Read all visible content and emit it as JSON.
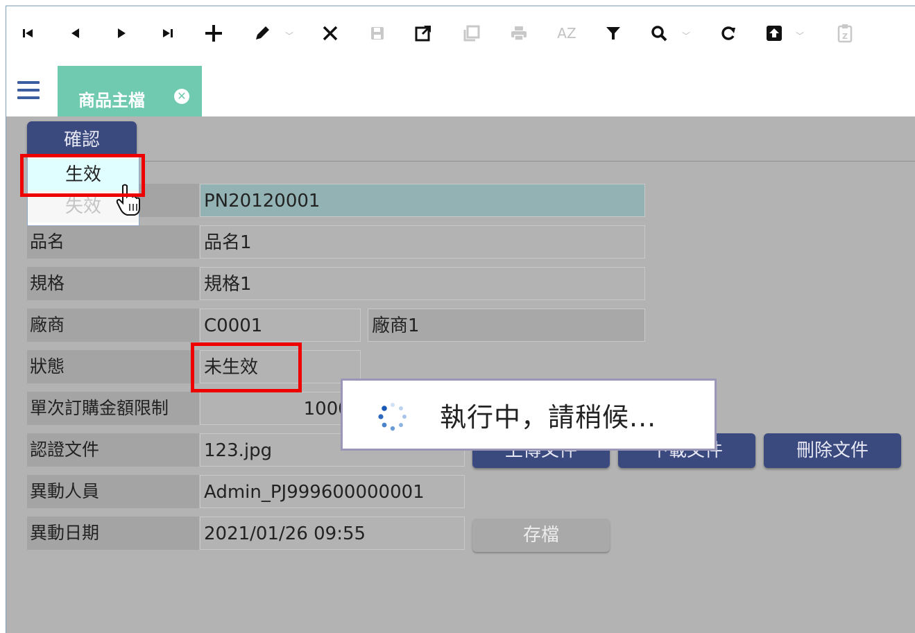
{
  "toolbar": {
    "buttons": [
      {
        "name": "first-record-button",
        "glyph": "⏮",
        "enabled": true
      },
      {
        "name": "prev-record-button",
        "glyph": "◀",
        "enabled": true
      },
      {
        "name": "next-record-button",
        "glyph": "▶",
        "enabled": true
      },
      {
        "name": "last-record-button",
        "glyph": "⏭",
        "enabled": true
      },
      {
        "name": "add-button",
        "glyph": "+",
        "enabled": true
      },
      {
        "name": "edit-button",
        "glyph": "✎",
        "enabled": true
      },
      {
        "name": "delete-button",
        "glyph": "✕",
        "enabled": true
      },
      {
        "name": "save-button",
        "glyph": "💾",
        "enabled": false
      },
      {
        "name": "open-external-button",
        "glyph": "⧉",
        "enabled": true
      },
      {
        "name": "copy-button",
        "glyph": "❐",
        "enabled": false
      },
      {
        "name": "print-button",
        "glyph": "⎙",
        "enabled": false
      },
      {
        "name": "sort-az-button",
        "glyph": "AZ",
        "enabled": false
      },
      {
        "name": "filter-button",
        "glyph": "▼",
        "enabled": true
      },
      {
        "name": "search-button",
        "glyph": "🔍",
        "enabled": true
      },
      {
        "name": "refresh-button",
        "glyph": "↻",
        "enabled": true
      },
      {
        "name": "upload-button",
        "glyph": "⇪",
        "enabled": true
      },
      {
        "name": "clipboard-button",
        "glyph": "📋",
        "enabled": false
      }
    ]
  },
  "tabs": [
    {
      "label": "商品主檔",
      "active": true
    }
  ],
  "confirm_button": {
    "label": "確認"
  },
  "confirm_menu": {
    "items": [
      "生效",
      "失效"
    ],
    "highlighted": "生效"
  },
  "form": {
    "code_value": "PN20120001",
    "name_label": "品名",
    "name_value": "品名1",
    "spec_label": "規格",
    "spec_value": "規格1",
    "vendor_label": "廠商",
    "vendor_code": "C0001",
    "vendor_name": "廠商1",
    "status_label": "狀態",
    "status_value": "未生效",
    "limit_label": "單次訂購金額限制",
    "limit_value": "10000",
    "doc_label": "認證文件",
    "doc_value": "123.jpg",
    "modifier_label": "異動人員",
    "modifier_value": "Admin_PJ999600000001",
    "date_label": "異動日期",
    "date_value": "2021/01/26 09:55"
  },
  "buttons": {
    "upload": "上傳文件",
    "download": "下載文件",
    "delete_doc": "刪除文件",
    "save": "存檔"
  },
  "loading": {
    "text": "執行中，請稍候..."
  },
  "colors": {
    "accent_tab": "#6fcab0",
    "button_dark": "#3a4a7e",
    "highlight_red": "#ee0000",
    "form_bg": "#b3b3b3"
  }
}
